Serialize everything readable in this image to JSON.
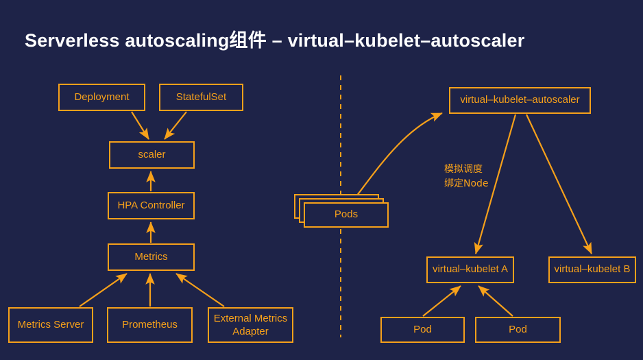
{
  "slide": {
    "title": "Serverless autoscaling组件 – virtual–kubelet–autoscaler",
    "background_color": "#1e2348",
    "accent_color": "#f7a11a",
    "title_color": "#ffffff"
  },
  "left_diagram": {
    "nodes": {
      "deployment": "Deployment",
      "statefulset": "StatefulSet",
      "scaler": "scaler",
      "hpa_controller": "HPA Controller",
      "metrics": "Metrics",
      "metrics_server": "Metrics Server",
      "prometheus": "Prometheus",
      "external_metrics_adapter": "External Metrics Adapter"
    }
  },
  "right_diagram": {
    "nodes": {
      "pods": "Pods",
      "autoscaler": "virtual–kubelet–autoscaler",
      "virtual_kubelet_a": "virtual–kubelet A",
      "virtual_kubelet_b": "virtual–kubelet B",
      "pod_a": "Pod",
      "pod_b": "Pod"
    },
    "annotation": {
      "line1": "模拟调度",
      "line2": "绑定Node"
    }
  }
}
